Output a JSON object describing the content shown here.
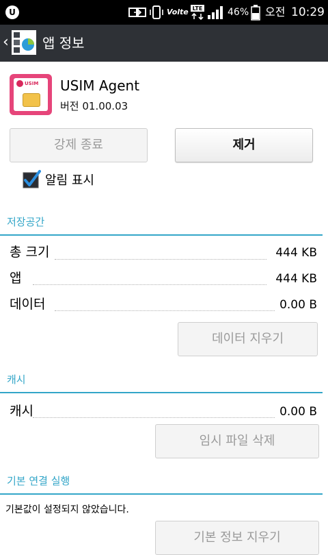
{
  "status_bar": {
    "battery": "46%",
    "ampm": "오전",
    "time": "10:29",
    "network": "LTE"
  },
  "action_bar": {
    "title": "앱 정보"
  },
  "app": {
    "name": "USIM Agent",
    "version": "버전 01.00.03",
    "icon_text": "USIM"
  },
  "buttons": {
    "force_stop": "강제 종료",
    "uninstall": "제거",
    "clear_data": "데이터 지우기",
    "clear_cache": "임시 파일 삭제",
    "clear_defaults": "기본 정보 지우기"
  },
  "notification": {
    "label": "알림 표시",
    "checked": true
  },
  "storage": {
    "title": "저장공간",
    "rows": [
      {
        "label": "총 크기",
        "value": "444 KB"
      },
      {
        "label": "앱",
        "value": "444 KB"
      },
      {
        "label": "데이터",
        "value": "0.00 B"
      }
    ]
  },
  "cache": {
    "title": "캐시",
    "rows": [
      {
        "label": "캐시",
        "value": "0.00 B"
      }
    ]
  },
  "launch": {
    "title": "기본 연결 실행",
    "note": "기본값이 설정되지 않았습니다."
  },
  "colors": {
    "accent": "#33a6c8",
    "action_bar": "#2e3136",
    "sim_pink": "#e6457a"
  }
}
